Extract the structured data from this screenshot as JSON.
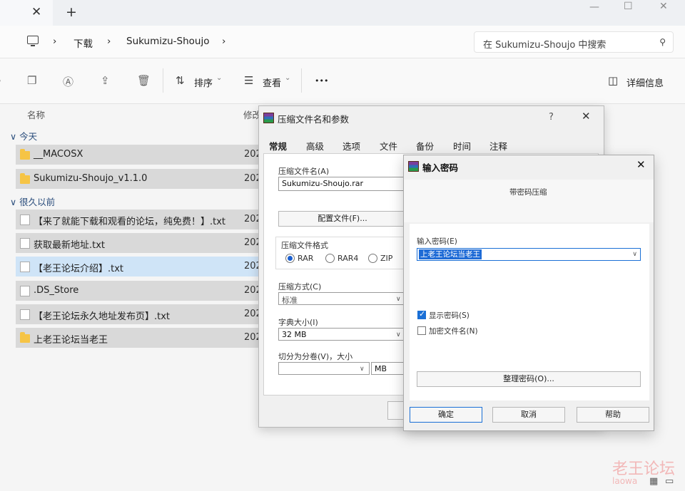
{
  "window": {
    "tab_close": "✕",
    "tab_new": "+",
    "minimize": "—",
    "maximize": "☐",
    "close": "✕"
  },
  "address": {
    "crumbs": [
      "下载",
      "Sukumizu-Shoujo"
    ],
    "separator": "›",
    "search_placeholder": "在 Sukumizu-Shoujo 中搜索"
  },
  "toolbar": {
    "sort_label": "排序",
    "view_label": "查看",
    "more": "•••",
    "details_label": "详细信息",
    "caret": "⌄"
  },
  "filelist": {
    "col_name": "名称",
    "col_modified": "修改",
    "groups": [
      {
        "label": "今天",
        "toggle": "∨"
      },
      {
        "label": "很久以前",
        "toggle": "∨"
      }
    ],
    "rows": [
      {
        "name": "__MACOSX",
        "date": "202",
        "type": "folder"
      },
      {
        "name": "Sukumizu-Shoujo_v1.1.0",
        "date": "202",
        "type": "folder"
      },
      {
        "name": "【来了就能下载和观看的论坛，纯免费！】.txt",
        "date": "202",
        "type": "file"
      },
      {
        "name": "获取最新地址.txt",
        "date": "202",
        "type": "file"
      },
      {
        "name": "【老王论坛介绍】.txt",
        "date": "202",
        "type": "file"
      },
      {
        "name": ".DS_Store",
        "date": "202",
        "type": "file"
      },
      {
        "name": "【老王论坛永久地址发布页】.txt",
        "date": "202",
        "type": "file"
      },
      {
        "name": "上老王论坛当老王",
        "date": "202",
        "type": "folder"
      }
    ]
  },
  "archive_dialog": {
    "title": "压缩文件名和参数",
    "help": "?",
    "close": "✕",
    "tabs": [
      "常规",
      "高级",
      "选项",
      "文件",
      "备份",
      "时间",
      "注释"
    ],
    "archive_name_label": "压缩文件名(A)",
    "archive_name_value": "Sukumizu-Shoujo.rar",
    "profile_button": "配置文件(F)...",
    "format_label": "压缩文件格式",
    "formats": [
      "RAR",
      "RAR4",
      "ZIP"
    ],
    "method_label": "压缩方式(C)",
    "method_value": "标准",
    "dict_label": "字典大小(I)",
    "dict_value": "32 MB",
    "split_label": "切分为分卷(V)，大小",
    "split_unit": "MB"
  },
  "password_dialog": {
    "title": "输入密码",
    "close": "✕",
    "heading": "带密码压缩",
    "password_label": "输入密码(E)",
    "password_value": "上老王论坛当老王",
    "show_password": "显示密码(S)",
    "encrypt_names": "加密文件名(N)",
    "organize_button": "整理密码(O)...",
    "ok": "确定",
    "cancel": "取消",
    "help": "帮助"
  },
  "watermark": {
    "text": "老王论坛",
    "subtext": "laowa"
  }
}
